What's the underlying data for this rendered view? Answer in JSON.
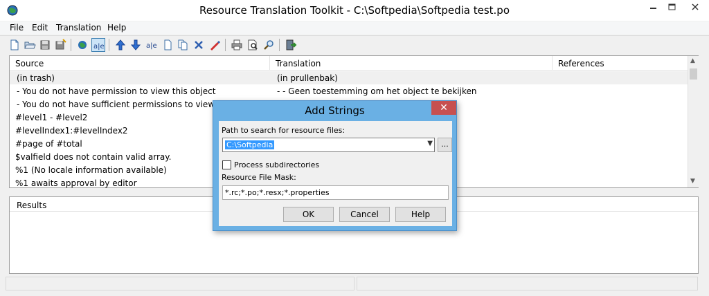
{
  "window": {
    "title": "Resource Translation Toolkit - C:\\Softpedia\\Softpedia test.po"
  },
  "window_controls": {
    "minimize": "—",
    "maximize": "☐",
    "close": "✕"
  },
  "menu": [
    "File",
    "Edit",
    "Translation",
    "Help"
  ],
  "toolbar": {
    "icons": [
      "new-document-icon",
      "open-folder-icon",
      "save-icon",
      "save-all-icon",
      "globe-icon",
      "translate-ab-icon",
      "move-up-icon",
      "move-down-icon",
      "translate-icon",
      "copy-icon",
      "copy-pages-icon",
      "delete-icon",
      "edit-pen-icon",
      "print-icon",
      "print-preview-icon",
      "find-icon",
      "exit-icon"
    ]
  },
  "grid": {
    "columns": [
      "Source",
      "Translation",
      "References"
    ],
    "rows": [
      {
        "source": " (in trash)",
        "translation": " (in prullenbak)"
      },
      {
        "source": " - You do not have permission to view this object",
        "translation": " - - Geen toestemming om het object te bekijken"
      },
      {
        "source": " - You do not have sufficient permissions to view this object",
        "translation": ""
      },
      {
        "source": "#level1 - #level2",
        "translation": ""
      },
      {
        "source": "#levelIndex1:#levelIndex2",
        "translation": ""
      },
      {
        "source": "#page of #total",
        "translation": ""
      },
      {
        "source": "$valfield does not contain valid array.",
        "translation": ""
      },
      {
        "source": "%1 (No locale information available)",
        "translation": ""
      },
      {
        "source": "%1 awaits approval by editor",
        "translation": ""
      }
    ]
  },
  "results": {
    "label": "Results"
  },
  "dialog": {
    "title": "Add Strings",
    "close": "✕",
    "path_label": "Path to search for resource files:",
    "path_value": "C:\\Softpedia",
    "browse_label": "...",
    "subdir_label": "Process subdirectories",
    "subdir_checked": false,
    "mask_label": "Resource File Mask:",
    "mask_value": "*.rc;*.po;*.resx;*.properties",
    "ok": "OK",
    "cancel": "Cancel",
    "help": "Help"
  }
}
